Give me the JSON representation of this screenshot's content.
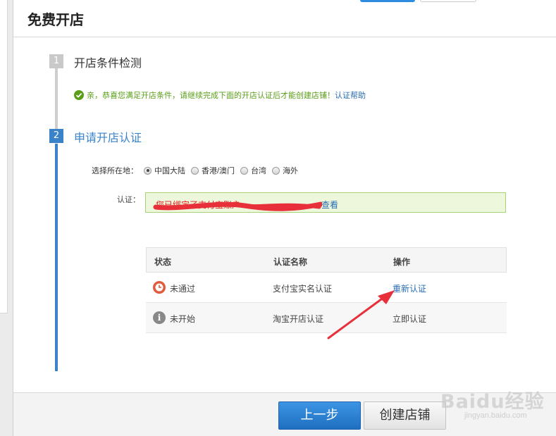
{
  "dialog": {
    "title": "免费开店"
  },
  "steps": [
    {
      "num": "1",
      "title": "开店条件检测"
    },
    {
      "num": "2",
      "title": "申请开店认证"
    }
  ],
  "check": {
    "message": "亲，恭喜您满足开店条件，请继续完成下面的开店认证后才能创建店铺！",
    "help_link": "认证帮助"
  },
  "region": {
    "label": "选择所在地：",
    "options": [
      "中国大陆",
      "香港/澳门",
      "台湾",
      "海外"
    ],
    "selected": "中国大陆"
  },
  "auth": {
    "label": "认证：",
    "text": "您已绑定了支付宝账户",
    "link": "查看"
  },
  "table": {
    "headers": [
      "状态",
      "认证名称",
      "操作"
    ],
    "rows": [
      {
        "status": "未通过",
        "name": "支付宝实名认证",
        "action": "重新认证"
      },
      {
        "status": "未开始",
        "name": "淘宝开店认证",
        "action": "立即认证"
      }
    ]
  },
  "buttons": {
    "prev": "上一步",
    "create": "创建店铺"
  },
  "watermark": {
    "main": "Baidu经验",
    "sub": "jingyan.baidu.com"
  },
  "colors": {
    "primary": "#3a83c9",
    "success": "#5a9e18",
    "error": "#e25a3c",
    "link": "#2a6db5",
    "annotation_arrow": "#e8303a"
  }
}
